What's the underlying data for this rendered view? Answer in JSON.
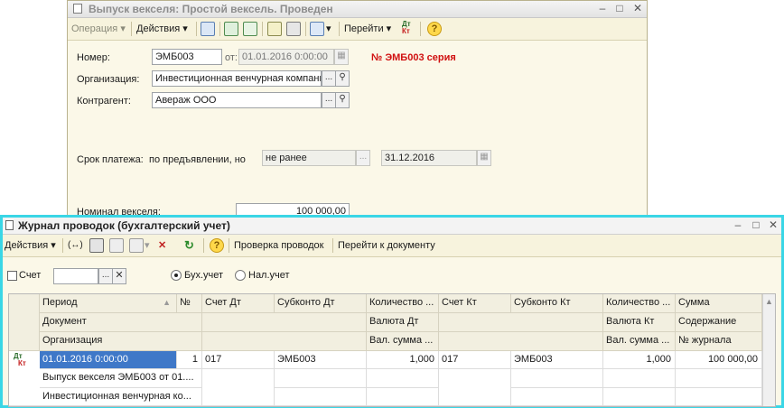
{
  "doc_window": {
    "title": "Выпуск векселя: Простой вексель. Проведен",
    "toolbar": {
      "operation": "Операция",
      "actions": "Действия",
      "goto": "Перейти",
      "dtkt_top": "Дт",
      "dtkt_bottom": "Кт"
    },
    "fields": {
      "number_label": "Номер:",
      "number_value": "ЭМБ003",
      "date_label": "от:",
      "date_value": "01.01.2016 0:00:00",
      "header_badge": "№ ЭМБ003 серия",
      "org_label": "Организация:",
      "org_value": "Инвестиционная венчурная компани",
      "contractor_label": "Контрагент:",
      "contractor_value": "Авераж ООО",
      "term_label": "Срок платежа:",
      "term_mode": "по предъявлении, но",
      "term_condition": "не ранее",
      "term_date": "31.12.2016",
      "nominal_label": "Номинал векселя:",
      "nominal_value": "100 000,00"
    }
  },
  "journal": {
    "title": "Журнал проводок (бухгалтерский учет)",
    "toolbar": {
      "actions": "Действия",
      "check": "Проверка проводок",
      "goto_doc": "Перейти к документу"
    },
    "filter": {
      "account_label": "Счет",
      "radio_buh": "Бух.учет",
      "radio_nal": "Нал.учет"
    },
    "columns": {
      "period": "Период",
      "document": "Документ",
      "organization": "Организация",
      "num": "№",
      "account_dt": "Счет Дт",
      "subconto_dt": "Субконто Дт",
      "qty_dt": "Количество ...",
      "currency_dt": "Валюта Дт",
      "cur_sum_dt": "Вал. сумма ...",
      "account_kt": "Счет Кт",
      "subconto_kt": "Субконто Кт",
      "qty_kt": "Количество ...",
      "currency_kt": "Валюта Кт",
      "cur_sum_kt": "Вал. сумма ...",
      "sum": "Сумма",
      "content": "Содержание",
      "journal_no": "№ журнала"
    },
    "rows": [
      {
        "icon_top": "Дт",
        "icon_bottom": "Кт",
        "period": "01.01.2016 0:00:00",
        "num": "1",
        "document": "Выпуск векселя ЭМБ003 от 01....",
        "organization": "Инвестиционная венчурная ко...",
        "account_dt": "017",
        "subconto_dt": "ЭМБ003",
        "qty_dt": "1,000",
        "account_kt": "017",
        "subconto_kt": "ЭМБ003",
        "qty_kt": "1,000",
        "sum": "100 000,00"
      }
    ]
  },
  "colors": {
    "accent_border": "#3ad6e6",
    "selection": "#3f78c8",
    "badge_red": "#d01010",
    "window_bg": "#fbf8e8"
  }
}
